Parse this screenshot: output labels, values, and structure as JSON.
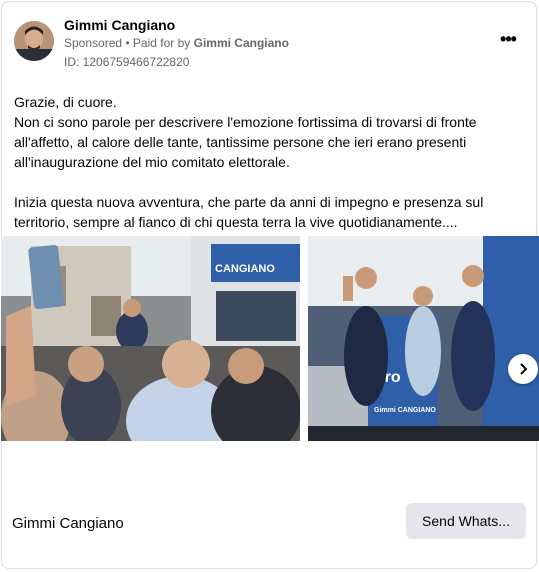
{
  "post": {
    "author": "Gimmi Cangiano",
    "sponsored_label": "Sponsored",
    "separator": " • ",
    "paid_for_prefix": "Paid for by ",
    "paid_for_name": "Gimmi Cangiano",
    "ad_id": "ID: 1206759466722820",
    "menu_glyph": "•••"
  },
  "body": {
    "line1": "Grazie, di cuore.",
    "paragraph1": "Non ci sono parole per descrivere l'emozione fortissima di trovarsi di fronte all'affetto, al calore delle tante, tantissime persone che ieri erano presenti all'inaugurazione del mio comitato elettorale.",
    "paragraph2": "Inizia questa nuova avventura, che parte da anni di impegno e presenza sul territorio, sempre al fianco di chi questa terra la vive quotidianamente...."
  },
  "carousel": {
    "sign_text_1": "CANGIANO",
    "sign_text_2": "Pro",
    "sign_text_3": "Gimmi CANGIANO"
  },
  "footer": {
    "page_name": "Gimmi Cangiano",
    "cta_label": "Send Whats..."
  },
  "colors": {
    "secondary_text": "#65676b",
    "button_bg": "#e4e6eb",
    "campaign_blue": "#2f5fa8"
  }
}
